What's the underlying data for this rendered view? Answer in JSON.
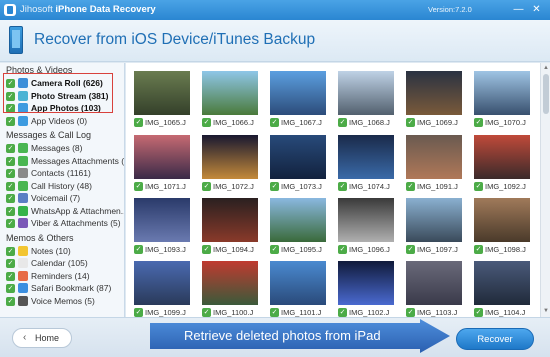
{
  "window": {
    "brand": "Jihosoft",
    "product": "iPhone Data Recovery",
    "version": "Version:7.2.0",
    "minimize": "—",
    "close": "✕"
  },
  "header": {
    "title": "Recover from iOS Device/iTunes Backup"
  },
  "sidebar": {
    "groups": [
      {
        "title": "Photos & Videos",
        "items": [
          {
            "label": "Camera Roll (626)",
            "icon": "camera-roll-icon",
            "color": "#3c8fd9"
          },
          {
            "label": "Photo Stream (381)",
            "icon": "photo-stream-icon",
            "color": "#4bb3d4"
          },
          {
            "label": "App Photos (103)",
            "icon": "app-photos-icon",
            "color": "#3d9be0"
          },
          {
            "label": "App Videos (0)",
            "icon": "app-videos-icon",
            "color": "#3d9be0"
          }
        ]
      },
      {
        "title": "Messages & Call Log",
        "items": [
          {
            "label": "Messages (8)",
            "icon": "messages-icon",
            "color": "#4ab652"
          },
          {
            "label": "Messages Attachments (...",
            "icon": "messages-attachments-icon",
            "color": "#4ab652"
          },
          {
            "label": "Contacts (1161)",
            "icon": "contacts-icon",
            "color": "#8a8a8a"
          },
          {
            "label": "Call History (48)",
            "icon": "call-history-icon",
            "color": "#4ab652"
          },
          {
            "label": "Voicemail (7)",
            "icon": "voicemail-icon",
            "color": "#5a7ec4"
          },
          {
            "label": "WhatsApp & Attachmen...",
            "icon": "whatsapp-icon",
            "color": "#35b34a"
          },
          {
            "label": "Viber & Attachments (5)",
            "icon": "viber-icon",
            "color": "#7b58b8"
          }
        ]
      },
      {
        "title": "Memos & Others",
        "items": [
          {
            "label": "Notes (10)",
            "icon": "notes-icon",
            "color": "#f2c531"
          },
          {
            "label": "Calendar (105)",
            "icon": "calendar-icon",
            "color": "#e8e8e8"
          },
          {
            "label": "Reminders (14)",
            "icon": "reminders-icon",
            "color": "#e76b46"
          },
          {
            "label": "Safari Bookmark (87)",
            "icon": "safari-icon",
            "color": "#3b8fe0"
          },
          {
            "label": "Voice Memos (5)",
            "icon": "voice-memos-icon",
            "color": "#555555"
          }
        ]
      }
    ]
  },
  "photos": [
    {
      "name": "IMG_1065.J",
      "colors": [
        "#6a7c50",
        "#34402a"
      ]
    },
    {
      "name": "IMG_1066.J",
      "colors": [
        "#8fc6e8",
        "#4a7a3a"
      ]
    },
    {
      "name": "IMG_1067.J",
      "colors": [
        "#5c9fe0",
        "#2c4c7a"
      ]
    },
    {
      "name": "IMG_1068.J",
      "colors": [
        "#bfd2e6",
        "#52606e"
      ]
    },
    {
      "name": "IMG_1069.J",
      "colors": [
        "#2a3242",
        "#7a5a3a"
      ]
    },
    {
      "name": "IMG_1070.J",
      "colors": [
        "#9fc4e4",
        "#38506e"
      ]
    },
    {
      "name": "IMG_1071.J",
      "colors": [
        "#c66a72",
        "#3a2a48"
      ]
    },
    {
      "name": "IMG_1072.J",
      "colors": [
        "#181830",
        "#c48a3a"
      ]
    },
    {
      "name": "IMG_1073.J",
      "colors": [
        "#284a7a",
        "#12223e"
      ]
    },
    {
      "name": "IMG_1074.J",
      "colors": [
        "#1a2a4a",
        "#3a6aa8"
      ]
    },
    {
      "name": "IMG_1091.J",
      "colors": [
        "#6a5a50",
        "#b07858"
      ]
    },
    {
      "name": "IMG_1092.J",
      "colors": [
        "#c04a3a",
        "#3a2a2a"
      ]
    },
    {
      "name": "IMG_1093.J",
      "colors": [
        "#2a3a6a",
        "#6a7ab0"
      ]
    },
    {
      "name": "IMG_1094.J",
      "colors": [
        "#2a2020",
        "#8a3a2a"
      ]
    },
    {
      "name": "IMG_1095.J",
      "colors": [
        "#8ab8e0",
        "#3a6a3a"
      ]
    },
    {
      "name": "IMG_1096.J",
      "colors": [
        "#3a3a3a",
        "#b0b0b0"
      ]
    },
    {
      "name": "IMG_1097.J",
      "colors": [
        "#8ab0d0",
        "#3a4a5a"
      ]
    },
    {
      "name": "IMG_1098.J",
      "colors": [
        "#a07a5a",
        "#4a3a2a"
      ]
    },
    {
      "name": "IMG_1099.J",
      "colors": [
        "#4a6ab0",
        "#2a3a5a"
      ]
    },
    {
      "name": "IMG_1100.J",
      "colors": [
        "#c03a30",
        "#3a5a3a"
      ]
    },
    {
      "name": "IMG_1101.J",
      "colors": [
        "#4a8ad0",
        "#2a4a7a"
      ]
    },
    {
      "name": "IMG_1102.J",
      "colors": [
        "#101a3a",
        "#4a6ad0"
      ]
    },
    {
      "name": "IMG_1103.J",
      "colors": [
        "#6a6a7a",
        "#3a3a4a"
      ]
    },
    {
      "name": "IMG_1104.J",
      "colors": [
        "#4a5a7a",
        "#202a3a"
      ]
    }
  ],
  "footer": {
    "home_label": "Home",
    "banner_text": "Retrieve deleted photos from iPad",
    "recover_label": "Recover"
  }
}
